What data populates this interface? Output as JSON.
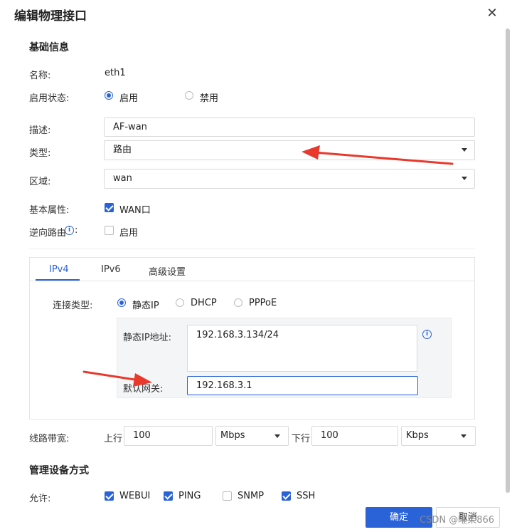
{
  "dialog": {
    "title": "编辑物理接口",
    "close_glyph": "✕"
  },
  "basic": {
    "section_title": "基础信息",
    "name_label": "名称:",
    "name_value": "eth1",
    "status_label": "启用状态:",
    "status_on": "启用",
    "status_off": "禁用",
    "desc_label": "描述:",
    "desc_value": "AF-wan",
    "type_label": "类型:",
    "type_value": "路由",
    "zone_label": "区域:",
    "zone_value": "wan",
    "attr_label": "基本属性:",
    "attr_wan": "WAN口",
    "reverse_label": "逆向路由",
    "reverse_colon": ":",
    "reverse_enable": "启用",
    "info_glyph": "i"
  },
  "tabs": [
    {
      "label": "IPv4"
    },
    {
      "label": "IPv6"
    },
    {
      "label": "高级设置"
    }
  ],
  "ipv4": {
    "conn_label": "连接类型:",
    "opt_static": "静态IP",
    "opt_dhcp": "DHCP",
    "opt_pppoe": "PPPoE",
    "static_ip_label": "静态IP地址:",
    "static_ip_value": "192.168.3.134/24",
    "gateway_label": "默认网关:",
    "gateway_value": "192.168.3.1"
  },
  "bandwidth": {
    "label": "线路带宽:",
    "up_label": "上行",
    "up_value": "100",
    "up_unit": "Mbps",
    "down_label": "下行",
    "down_value": "100",
    "down_unit": "Kbps"
  },
  "mgmt": {
    "section_title": "管理设备方式",
    "allow_label": "允许:",
    "options": [
      {
        "label": "WEBUI",
        "checked": true
      },
      {
        "label": "PING",
        "checked": true
      },
      {
        "label": "SNMP",
        "checked": false
      },
      {
        "label": "SSH",
        "checked": true
      }
    ]
  },
  "footer": {
    "confirm": "确定",
    "cancel": "取消",
    "watermark": "CSDN @曜柴866"
  },
  "colors": {
    "accent": "#2a62d8",
    "annotation_arrow": "#e8392c"
  }
}
